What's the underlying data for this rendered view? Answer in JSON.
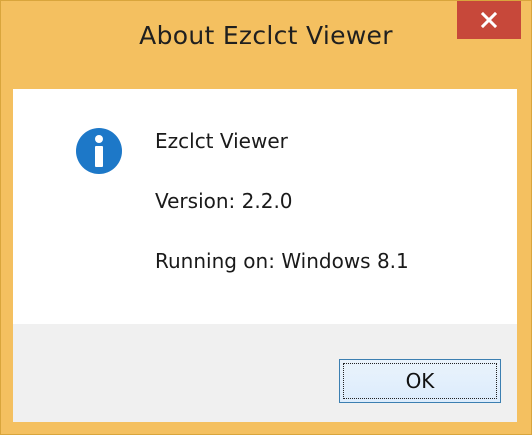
{
  "window": {
    "title": "About Ezclct Viewer"
  },
  "about": {
    "app_name": "Ezclct Viewer",
    "version": "Version: 2.2.0",
    "platform": "Running on: Windows 8.1"
  },
  "buttons": {
    "ok_label": "OK"
  },
  "icons": {
    "info": "info-icon",
    "close": "close-icon"
  },
  "colors": {
    "frame": "#f4c060",
    "close_button": "#c7483a",
    "info_icon": "#1d78c8",
    "footer": "#f0f0f0"
  }
}
